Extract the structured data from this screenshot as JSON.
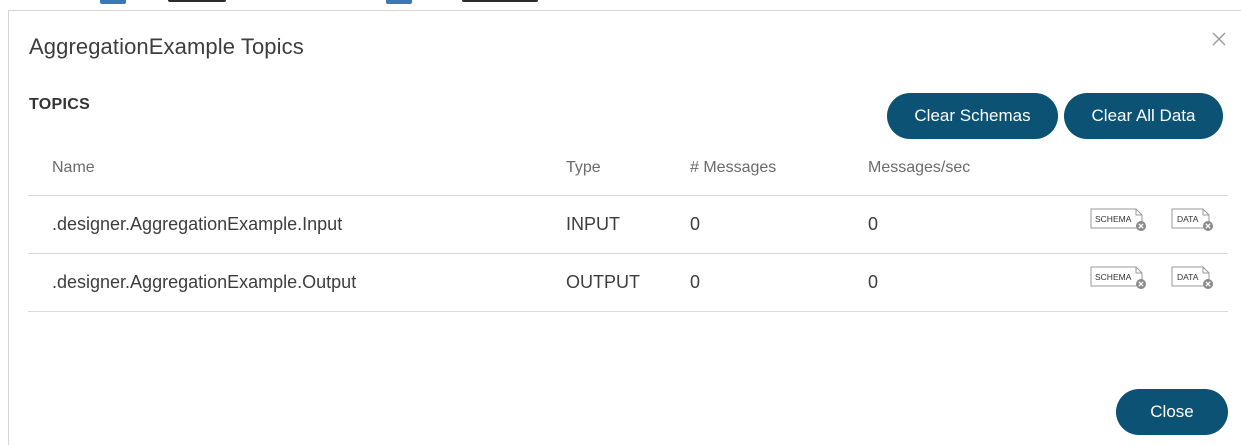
{
  "dialog": {
    "title": "AggregationExample Topics",
    "section_label": "TOPICS",
    "close_icon": "close-icon"
  },
  "actions": {
    "clear_schemas_label": "Clear Schemas",
    "clear_all_data_label": "Clear All Data",
    "close_label": "Close"
  },
  "table": {
    "columns": {
      "name": "Name",
      "type": "Type",
      "messages": "# Messages",
      "rate": "Messages/sec"
    },
    "rows": [
      {
        "name": ".designer.AggregationExample.Input",
        "type": "INPUT",
        "messages": "0",
        "rate": "0",
        "schema_badge": "SCHEMA",
        "data_badge": "DATA"
      },
      {
        "name": ".designer.AggregationExample.Output",
        "type": "OUTPUT",
        "messages": "0",
        "rate": "0",
        "schema_badge": "SCHEMA",
        "data_badge": "DATA"
      }
    ]
  },
  "colors": {
    "accent": "#0b5275",
    "divider": "#d9d9d9",
    "header_text": "#6b6b6b",
    "body_text": "#3d3d3d"
  }
}
